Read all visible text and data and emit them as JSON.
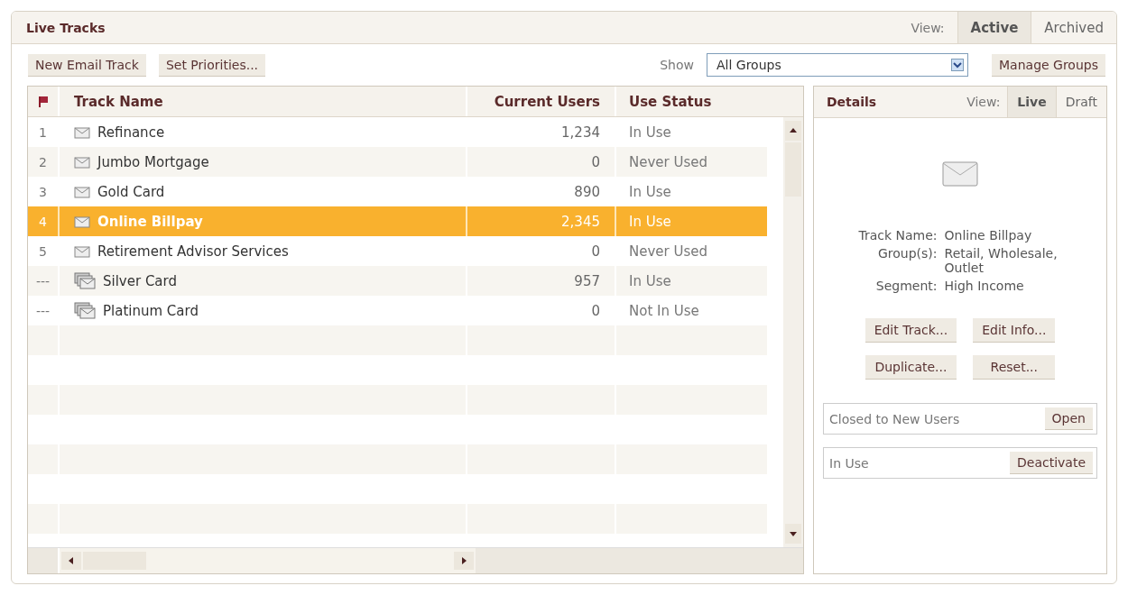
{
  "panel": {
    "title": "Live Tracks",
    "view_label": "View:",
    "view_tabs": [
      {
        "label": "Active",
        "selected": true
      },
      {
        "label": "Archived",
        "selected": false
      }
    ]
  },
  "toolbar": {
    "buttons": [
      "New Email Track",
      "Set Priorities..."
    ],
    "show_label": "Show",
    "group_select": "All Groups",
    "manage_button": "Manage Groups"
  },
  "table": {
    "columns": [
      "Track Name",
      "Current Users",
      "Use Status"
    ],
    "rows": [
      {
        "number": "1",
        "kind": "single",
        "name": "Refinance",
        "users": "1,234",
        "status": "In Use",
        "selected": false
      },
      {
        "number": "2",
        "kind": "single",
        "name": "Jumbo Mortgage",
        "users": "0",
        "status": "Never Used",
        "selected": false
      },
      {
        "number": "3",
        "kind": "single",
        "name": "Gold Card",
        "users": "890",
        "status": "In Use",
        "selected": false
      },
      {
        "number": "4",
        "kind": "single",
        "name": "Online Billpay",
        "users": "2,345",
        "status": "In Use",
        "selected": true
      },
      {
        "number": "5",
        "kind": "single",
        "name": "Retirement Advisor Services",
        "users": "0",
        "status": "Never Used",
        "selected": false
      },
      {
        "number": "---",
        "kind": "stack",
        "name": "Silver Card",
        "users": "957",
        "status": "In Use",
        "selected": false
      },
      {
        "number": "---",
        "kind": "stack",
        "name": "Platinum Card",
        "users": "0",
        "status": "Not In Use",
        "selected": false
      }
    ]
  },
  "details": {
    "title": "Details",
    "view_label": "View:",
    "view_tabs": [
      {
        "label": "Live",
        "selected": true
      },
      {
        "label": "Draft",
        "selected": false
      }
    ],
    "fields": [
      {
        "label": "Track Name:",
        "value": "Online Billpay"
      },
      {
        "label": "Group(s):",
        "value": "Retail, Wholesale, Outlet"
      },
      {
        "label": "Segment:",
        "value": "High Income"
      }
    ],
    "buttons": [
      "Edit Track...",
      "Edit Info...",
      "Duplicate...",
      "Reset..."
    ],
    "states": [
      {
        "text": "Closed to New Users",
        "button": "Open"
      },
      {
        "text": "In Use",
        "button": "Deactivate"
      }
    ]
  }
}
